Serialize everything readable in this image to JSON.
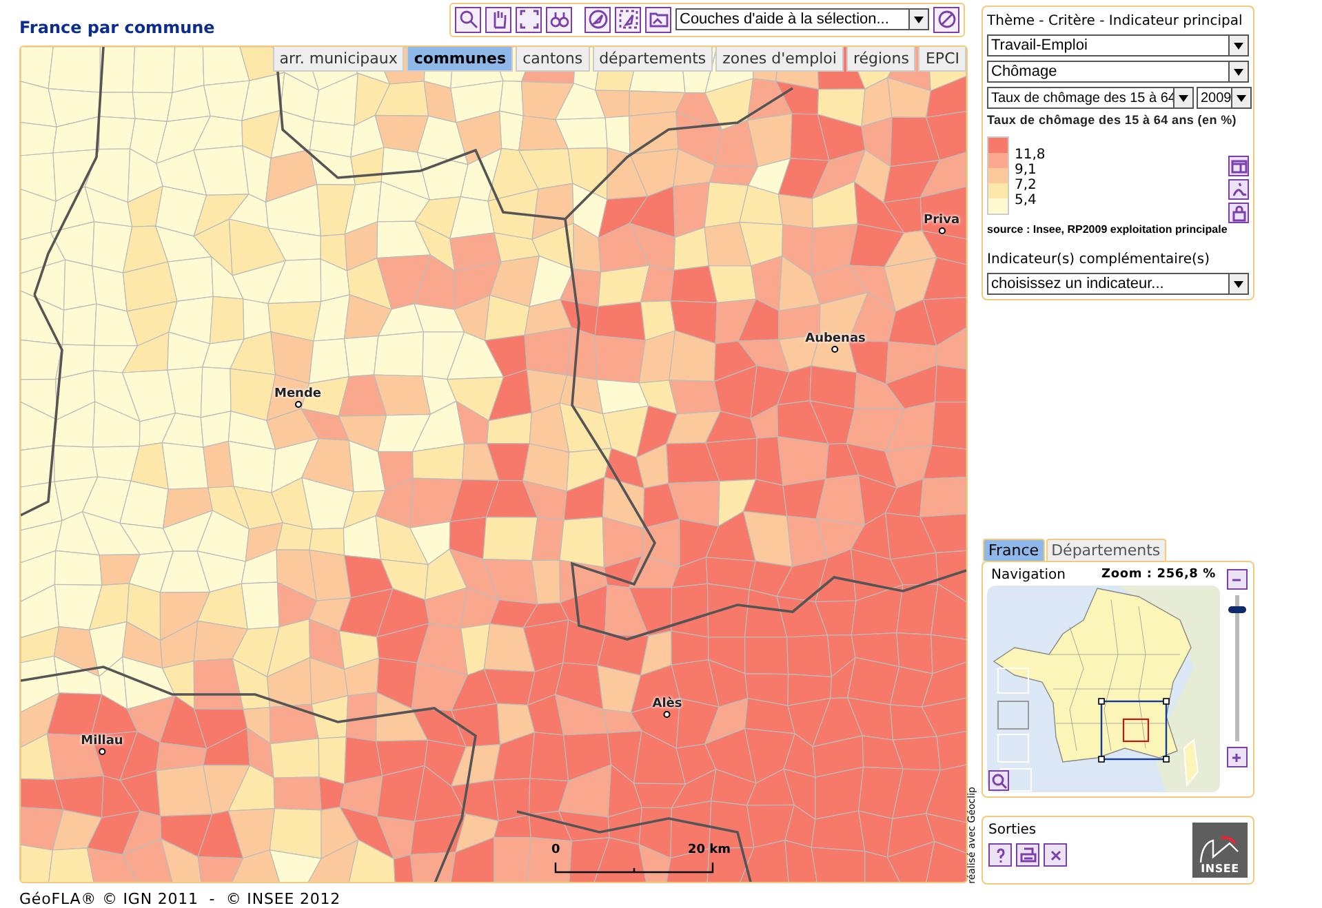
{
  "title": "France par commune",
  "toolbar": {
    "layers_select": "Couches d'aide à la sélection..."
  },
  "layer_tabs": [
    {
      "label": "arr. municipaux",
      "selected": false
    },
    {
      "label": "communes",
      "selected": true
    },
    {
      "label": "cantons",
      "selected": false
    },
    {
      "label": "départements",
      "selected": false
    },
    {
      "label": "zones d'emploi",
      "selected": false
    },
    {
      "label": "régions",
      "selected": false
    },
    {
      "label": "EPCI",
      "selected": false
    }
  ],
  "map": {
    "cities": [
      {
        "name": "Mende"
      },
      {
        "name": "Aubenas"
      },
      {
        "name": "Alès"
      },
      {
        "name": "Millau"
      },
      {
        "name": "Priva"
      }
    ],
    "scale": {
      "start": "0",
      "end": "20 km"
    }
  },
  "footer": "GéoFLA® © IGN 2011  -  © INSEE 2012",
  "credit": "réalisé avec Géoclip",
  "indicator_panel": {
    "heading": "Thème - Critère - Indicateur principal",
    "theme": "Travail-Emploi",
    "criterion": "Chômage",
    "indicator": "Taux de chômage des 15 à 64",
    "year": "2009",
    "legend": {
      "title": "Taux de chômage des 15 à 64 ans (en %)",
      "classes": [
        {
          "color": "#f7796a"
        },
        {
          "color": "#f9a88e"
        },
        {
          "color": "#fbc99c"
        },
        {
          "color": "#fde7a9"
        },
        {
          "color": "#fefbd2"
        }
      ],
      "breaks": [
        "11,8",
        "9,1",
        "7,2",
        "5,4"
      ]
    },
    "source": "source : Insee, RP2009 exploitation principale",
    "complementary_label": "Indicateur(s) complémentaire(s)",
    "complementary_select": "choisissez un indicateur..."
  },
  "nav_tabs": [
    {
      "label": "France",
      "selected": true
    },
    {
      "label": "Départements",
      "selected": false
    }
  ],
  "navigation": {
    "label": "Navigation",
    "zoom": "Zoom : 256,8 %",
    "zoom_slider": {
      "level": 0.92
    }
  },
  "outputs": {
    "label": "Sorties",
    "logo": "INSEE"
  }
}
